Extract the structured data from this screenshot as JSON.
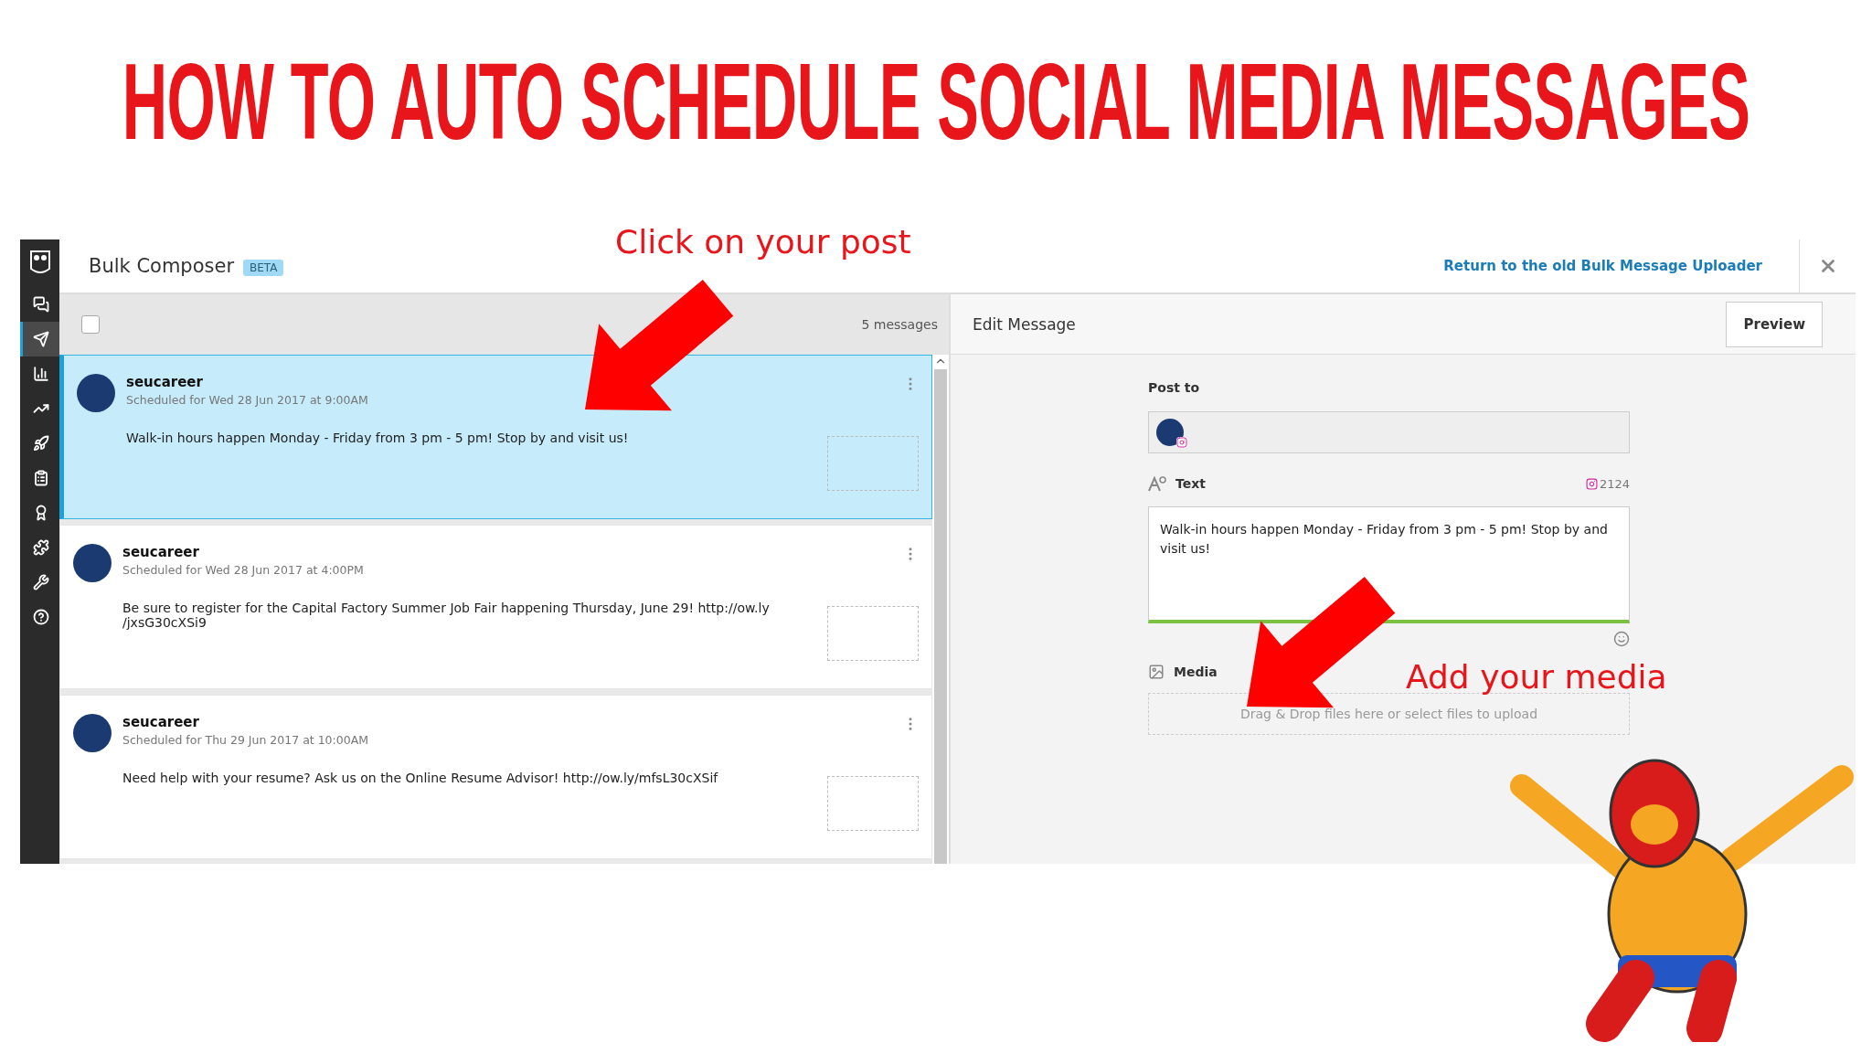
{
  "title": "HOW TO AUTO SCHEDULE SOCIAL MEDIA MESSAGES",
  "annotations": [
    {
      "text": "Click on your post"
    },
    {
      "text": "Add your media"
    }
  ],
  "sidebar": {
    "items": [
      {
        "selected": false
      },
      {
        "selected": true
      },
      {
        "selected": false
      },
      {
        "selected": false
      },
      {
        "selected": false
      },
      {
        "selected": false
      },
      {
        "selected": false
      },
      {
        "selected": false
      },
      {
        "selected": false
      },
      {
        "selected": false
      }
    ]
  },
  "header": {
    "title": "Bulk Composer",
    "badge": "BETA",
    "link": "Return to the old Bulk Message Uploader"
  },
  "list": {
    "select_all_checked": false,
    "count": "5 messages",
    "messages": [
      {
        "account": "seucareer",
        "scheduled": "Scheduled for Wed 28 Jun 2017 at 9:00AM",
        "text": "Walk-in hours happen Monday - Friday from 3 pm - 5 pm! Stop by and visit us!",
        "selected": true
      },
      {
        "account": "seucareer",
        "scheduled": "Scheduled for Wed 28 Jun 2017 at 4:00PM",
        "text": "Be sure to register for the Capital Factory Summer Job Fair happening Thursday, June 29! http://ow.ly\n/jxsG30cXSi9",
        "selected": false
      },
      {
        "account": "seucareer",
        "scheduled": "Scheduled for Thu 29 Jun 2017 at 10:00AM",
        "text": "Need help with your resume? Ask us on the Online Resume Advisor! http://ow.ly/mfsL30cXSif",
        "selected": false
      }
    ]
  },
  "editor": {
    "title": "Edit Message",
    "preview_button": "Preview",
    "post_to_label": "Post to",
    "text_label": "Text",
    "char_count": "2124",
    "text_value": "Walk-in hours happen Monday - Friday from 3 pm - 5 pm! Stop by and visit us!",
    "media_label": "Media",
    "dropzone": "Drag & Drop files here or select files to upload"
  }
}
